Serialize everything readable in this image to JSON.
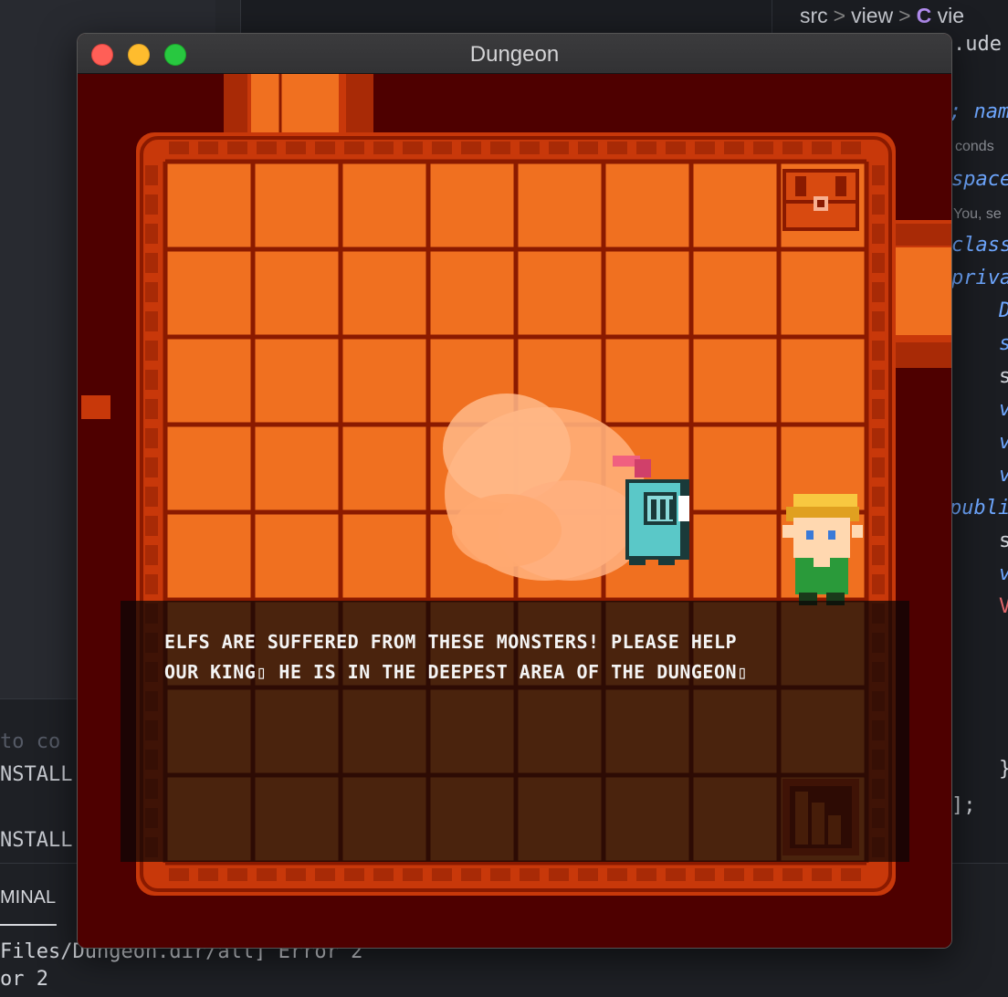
{
  "ide": {
    "breadcrumb": {
      "part1": "src",
      "part2": "view",
      "lang_badge": "C",
      "part3": "vie"
    },
    "code_lines": [
      ".ude",
      "; nam",
      "conds",
      "space",
      "You, se",
      "class",
      "priva",
      "D",
      "s",
      "s",
      "v",
      "v",
      "v",
      "publi",
      "s",
      "v",
      "V",
      "}",
      "];"
    ],
    "panel_lines": [
      "to co",
      "NSTALL",
      "NSTALL"
    ],
    "terminal_tab": "MINAL",
    "terminal_lines": [
      "Files/Dungeon.dir/all] Error 2",
      "or 2"
    ]
  },
  "window": {
    "title": "Dungeon",
    "buttons": {
      "close": "close",
      "minimize": "minimize",
      "maximize": "maximize"
    }
  },
  "game": {
    "dialog": {
      "line1": "ELFS ARE SUFFERED FROM THESE MONSTERS! PLEASE HELP",
      "line2": "OUR KING▯ HE IS IN THE DEEPEST AREA OF THE DUNGEON▯"
    },
    "entities": [
      "knight",
      "elf-npc",
      "treasure-chest",
      "smoke-cloud",
      "stairs"
    ],
    "colors": {
      "void": "#4e0000",
      "floor": "#f07020",
      "grid": "#8a1a00",
      "wall": "#d84a10",
      "knight": "#5ac8c8",
      "plume": "#f06080",
      "elf_hair": "#f8c840",
      "elf_tunic": "#2a9a3a",
      "smoke": "#ffae78"
    }
  }
}
